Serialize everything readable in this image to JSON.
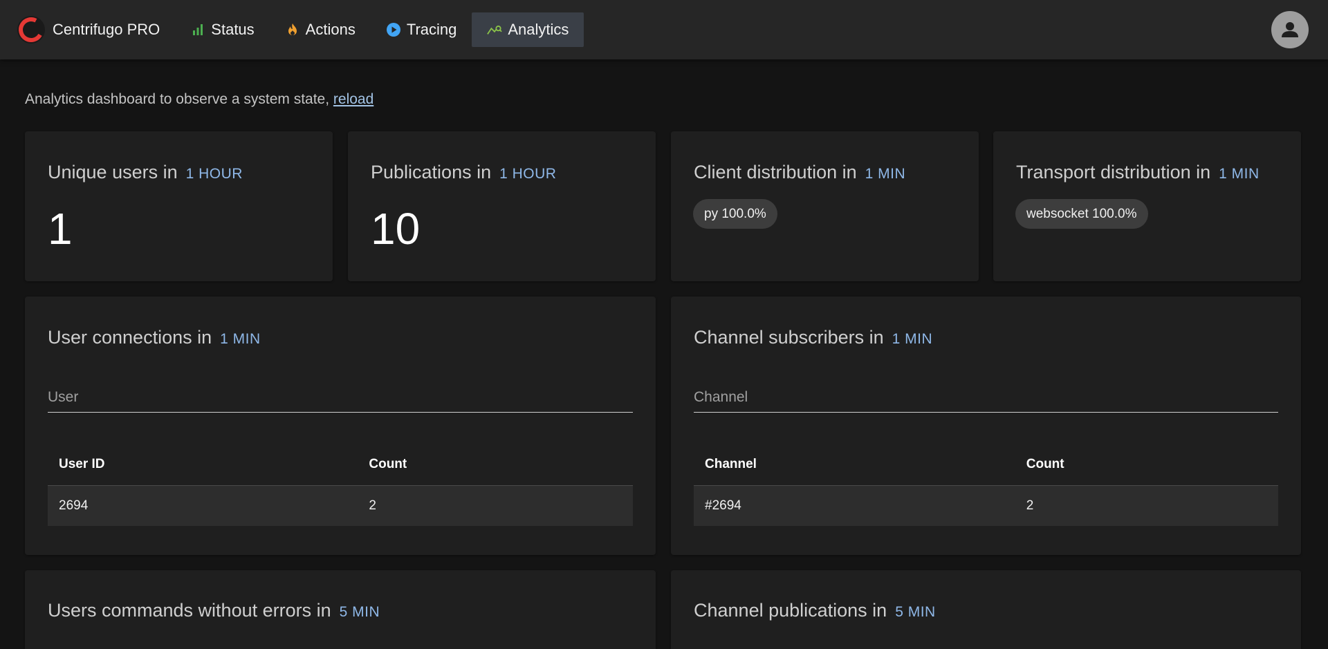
{
  "header": {
    "brand": "Centrifugo PRO",
    "nav": [
      {
        "label": "Status",
        "icon": "bar-chart-icon"
      },
      {
        "label": "Actions",
        "icon": "fire-icon"
      },
      {
        "label": "Tracing",
        "icon": "play-circle-icon"
      },
      {
        "label": "Analytics",
        "icon": "analytics-icon",
        "active": true
      }
    ],
    "avatar_icon": "user-icon"
  },
  "intro": {
    "text": "Analytics dashboard to observe a system state, ",
    "link": "reload"
  },
  "cards": {
    "unique_users": {
      "title": "Unique users in",
      "period": "1 HOUR",
      "value": "1"
    },
    "publications": {
      "title": "Publications in",
      "period": "1 HOUR",
      "value": "10"
    },
    "client_dist": {
      "title": "Client distribution in",
      "period": "1 MIN",
      "chip": "py 100.0%"
    },
    "transport_dist": {
      "title": "Transport distribution in",
      "period": "1 MIN",
      "chip": "websocket 100.0%"
    },
    "user_connections": {
      "title": "User connections in",
      "period": "1 MIN",
      "filter_placeholder": "User",
      "columns": [
        "User ID",
        "Count"
      ],
      "rows": [
        [
          "2694",
          "2"
        ]
      ]
    },
    "channel_subscribers": {
      "title": "Channel subscribers in",
      "period": "1 MIN",
      "filter_placeholder": "Channel",
      "columns": [
        "Channel",
        "Count"
      ],
      "rows": [
        [
          "#2694",
          "2"
        ]
      ]
    },
    "users_commands": {
      "title": "Users commands without errors in",
      "period": "5 MIN"
    },
    "channel_publications": {
      "title": "Channel publications in",
      "period": "5 MIN"
    }
  },
  "colors": {
    "accent_period": "#8fb8e8",
    "status_icon": "#4caf50",
    "actions_icon": "#f0a030",
    "tracing_icon": "#42a5f5",
    "analytics_icon": "#8bc34a"
  }
}
